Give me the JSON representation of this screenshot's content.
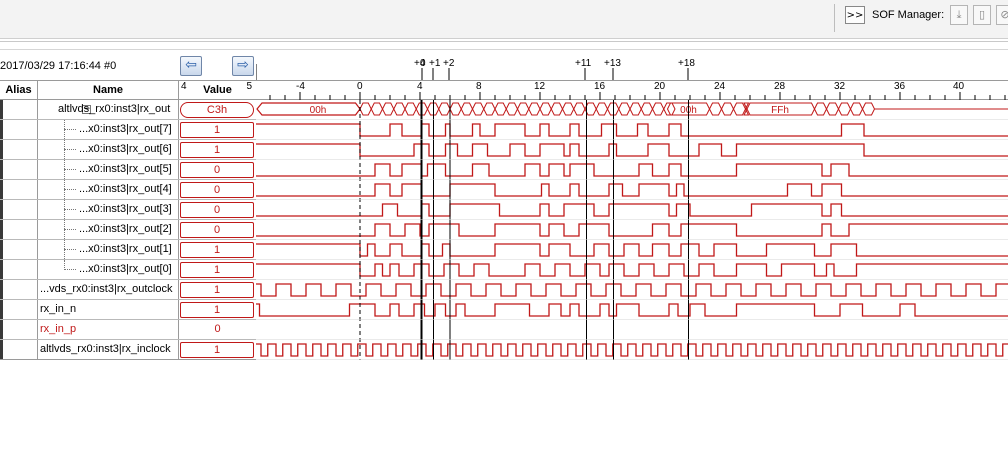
{
  "toolbar": {
    "expand_label": ">>",
    "sof_label": "SOF Manager:",
    "icons": [
      "download-icon",
      "file-icon",
      "stop-icon"
    ]
  },
  "timestamp": "2017/03/29 17:16:44  #0",
  "columns": {
    "alias": "Alias",
    "name": "Name",
    "value": "Value",
    "value_left": "4",
    "value_right": "5"
  },
  "ruler": {
    "ticks": [
      "-4",
      "0",
      "4",
      "8",
      "12",
      "16",
      "20",
      "24",
      "28",
      "32",
      "36",
      "40"
    ],
    "markers": [
      "+4",
      "0",
      "+1",
      "+2",
      "+11",
      "+13",
      "+18"
    ]
  },
  "signals": [
    {
      "name": "altlvds_rx0:inst3|rx_out",
      "value": "C3h",
      "bus": true,
      "bus_labels": [
        "00h",
        "00h",
        "FFh"
      ]
    },
    {
      "name": "...x0:inst3|rx_out[7]",
      "value": "1",
      "child": true
    },
    {
      "name": "...x0:inst3|rx_out[6]",
      "value": "1",
      "child": true
    },
    {
      "name": "...x0:inst3|rx_out[5]",
      "value": "0",
      "child": true
    },
    {
      "name": "...x0:inst3|rx_out[4]",
      "value": "0",
      "child": true
    },
    {
      "name": "...x0:inst3|rx_out[3]",
      "value": "0",
      "child": true
    },
    {
      "name": "...x0:inst3|rx_out[2]",
      "value": "0",
      "child": true
    },
    {
      "name": "...x0:inst3|rx_out[1]",
      "value": "1",
      "child": true
    },
    {
      "name": "...x0:inst3|rx_out[0]",
      "value": "1",
      "child": true,
      "last": true
    },
    {
      "name": "...vds_rx0:inst3|rx_outclock",
      "value": "1"
    },
    {
      "name": "rx_in_n",
      "value": "1"
    },
    {
      "name": "rx_in_p",
      "value": "0",
      "red_name": true
    },
    {
      "name": "altlvds_rx0:inst3|rx_inclock",
      "value": "1"
    }
  ],
  "colors": {
    "wave": "#c01818",
    "grid": "#000000"
  }
}
